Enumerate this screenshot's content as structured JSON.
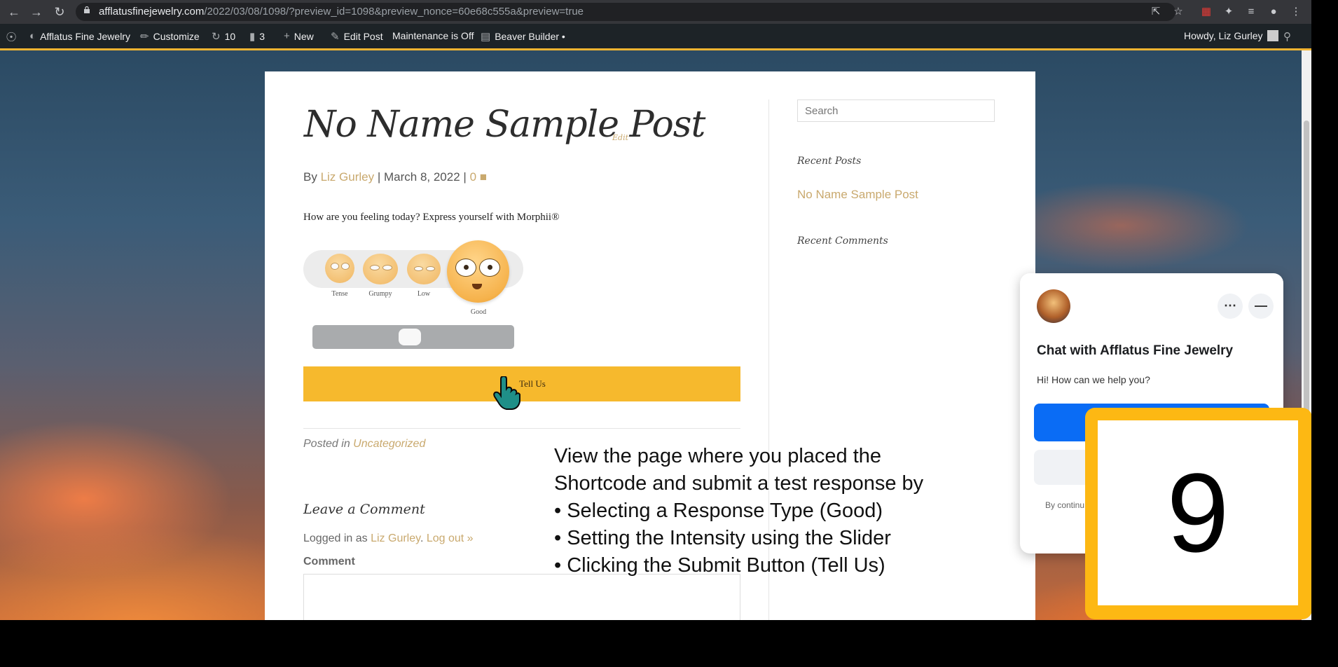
{
  "browser": {
    "url_host": "afflatusfinejewelry.com",
    "url_path": "/2022/03/08/1098/?preview_id=1098&preview_nonce=60e68c555a&preview=true"
  },
  "admin_bar": {
    "site_name": "Afflatus Fine Jewelry",
    "customize": "Customize",
    "updates_count": "10",
    "comments_count": "3",
    "new": "New",
    "edit_post": "Edit Post",
    "maintenance": "Maintenance is Off",
    "builder": "Beaver Builder •",
    "howdy": "Howdy, Liz Gurley"
  },
  "post": {
    "title": "No Name Sample Post",
    "edit": "Edit",
    "by": "By",
    "author": "Liz Gurley",
    "sep1": "|",
    "date": "March 8, 2022",
    "sep2": "|",
    "comments": "0",
    "intro": "How are you feeling today? Express yourself with Morphii®"
  },
  "morphii": {
    "emotions": [
      "Tense",
      "Grumpy",
      "Low",
      "Good"
    ],
    "selected": "Good",
    "intensity": 0.48,
    "submit_label": "Tell Us"
  },
  "footer": {
    "posted_in_label": "Posted in",
    "category": "Uncategorized",
    "leave_comment": "Leave a Comment",
    "logged_in_as": "Logged in as",
    "user": "Liz Gurley",
    "logout": "Log out »",
    "comment_label": "Comment"
  },
  "sidebar": {
    "search_placeholder": "Search",
    "recent_posts_title": "Recent Posts",
    "recent_post_link": "No Name Sample Post",
    "recent_comments_title": "Recent Comments"
  },
  "caption": {
    "line1": "View the page where you placed the",
    "line2": "Shortcode and submit a test response by",
    "line3": "• Selecting a Response Type (Good)",
    "line4": "• Setting the Intensity using the Slider",
    "line5": "• Clicking the Submit Button (Tell Us)"
  },
  "chat": {
    "title": "Chat with Afflatus Fine Jewelry",
    "subtitle": "Hi! How can we help you?",
    "consent": "By continu"
  },
  "step_number": "9",
  "colors": {
    "accent_gold": "#c9a96e",
    "button_yellow": "#f6b92d",
    "messenger_blue": "#0a6cf5",
    "number_frame": "#fdb813"
  }
}
